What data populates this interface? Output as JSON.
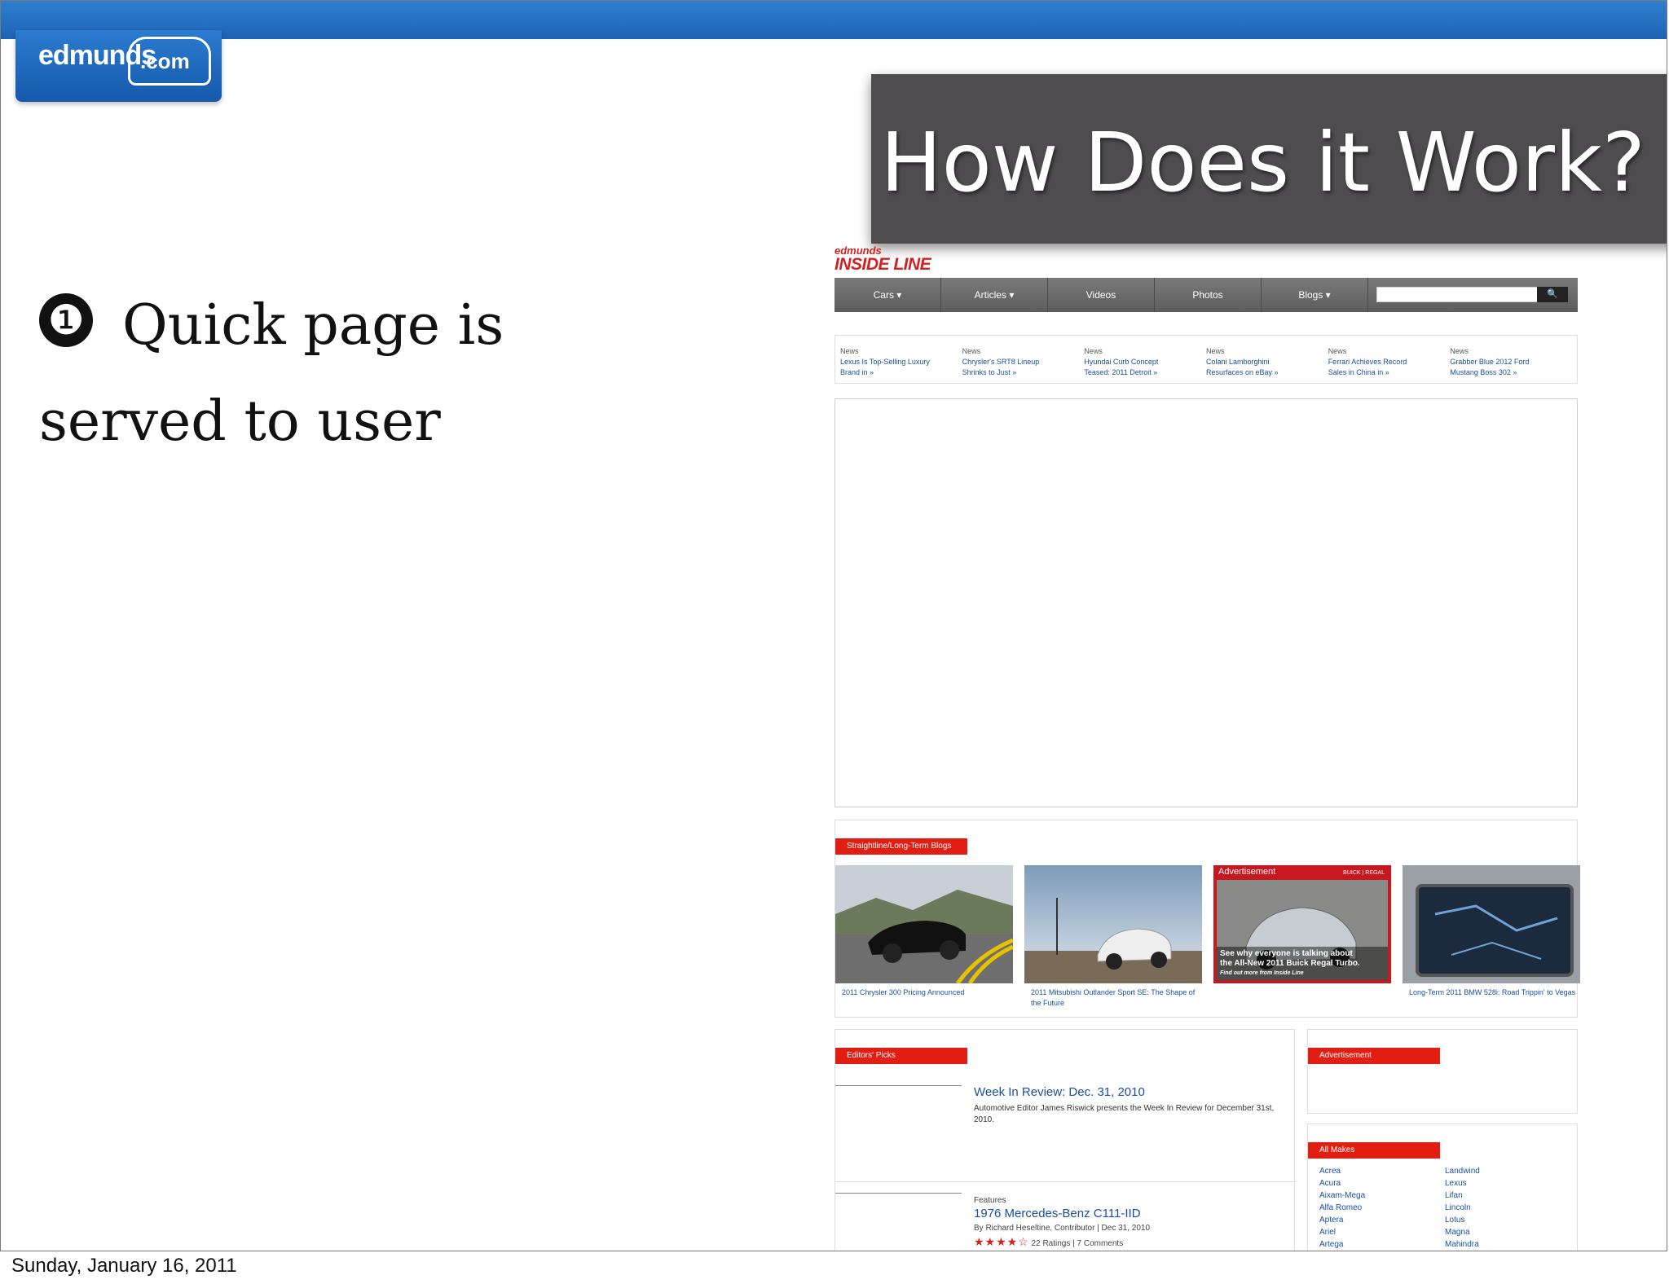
{
  "slide": {
    "logo": {
      "text": "edmunds",
      "badge": ".com"
    },
    "title": "How Does it Work?",
    "bullet_number": "❶",
    "bullet_line1": "Quick page is",
    "bullet_line2": "served to user",
    "footer_date": "Sunday, January 16, 2011"
  },
  "site": {
    "logo_small": "edmunds",
    "logo_big": "INSIDE LINE",
    "nav": [
      "Cars ▾",
      "Articles ▾",
      "Videos",
      "Photos",
      "Blogs ▾"
    ],
    "search_icon": "🔍",
    "news": [
      {
        "cat": "News",
        "title1": "Lexus Is Top-Selling Luxury",
        "title2": "Brand in »"
      },
      {
        "cat": "News",
        "title1": "Chrysler's SRT8 Lineup",
        "title2": "Shrinks to Just »"
      },
      {
        "cat": "News",
        "title1": "Hyundai Curb Concept",
        "title2": "Teased: 2011 Detroit »"
      },
      {
        "cat": "News",
        "title1": "Colani Lamborghini",
        "title2": "Resurfaces on eBay »"
      },
      {
        "cat": "News",
        "title1": "Ferrari Achieves Record",
        "title2": "Sales in China in »"
      },
      {
        "cat": "News",
        "title1": "Grabber Blue 2012 Ford",
        "title2": "Mustang Boss 302 »"
      }
    ],
    "blogs_label": "Straightline/Long-Term Blogs",
    "blog_captions": [
      "2011 Chrysler 300 Pricing Announced",
      "2011 Mitsubishi Outlander Sport SE: The Shape of the Future",
      "",
      "Long-Term 2011 BMW 528i: Road Trippin' to Vegas"
    ],
    "blog_ad": {
      "label": "Advertisement",
      "brand": "BUICK | REGAL",
      "copy1": "See why everyone is talking about",
      "copy2": "the All-New 2011 Buick Regal Turbo.",
      "sub": "Find out more from Inside Line"
    },
    "editors_label": "Editors' Picks",
    "story1": {
      "title": "Week In Review: Dec. 31, 2010",
      "desc": "Automotive Editor James Riswick presents the Week In Review for December 31st, 2010."
    },
    "story2": {
      "cat": "Features",
      "title": "1976 Mercedes-Benz C111-IID",
      "byline": "By Richard Heseltine, Contributor | Dec 31, 2010",
      "stars": "★★★★☆",
      "rating": "22 Ratings | 7 Comments"
    },
    "ad_label": "Advertisement",
    "makes_label": "All Makes",
    "makes_col1": [
      "Acrea",
      "Acura",
      "Aixam-Mega",
      "Alfa Romeo",
      "Aptera",
      "Ariel",
      "Artega"
    ],
    "makes_col2": [
      "Landwind",
      "Lexus",
      "Lifan",
      "Lincoln",
      "Lotus",
      "Magna",
      "Mahindra"
    ]
  },
  "colors": {
    "topbar": "#1e63b3",
    "title_bg": "#4f4c50",
    "site_red": "#e21d12",
    "link_blue": "#1a4fa3"
  }
}
